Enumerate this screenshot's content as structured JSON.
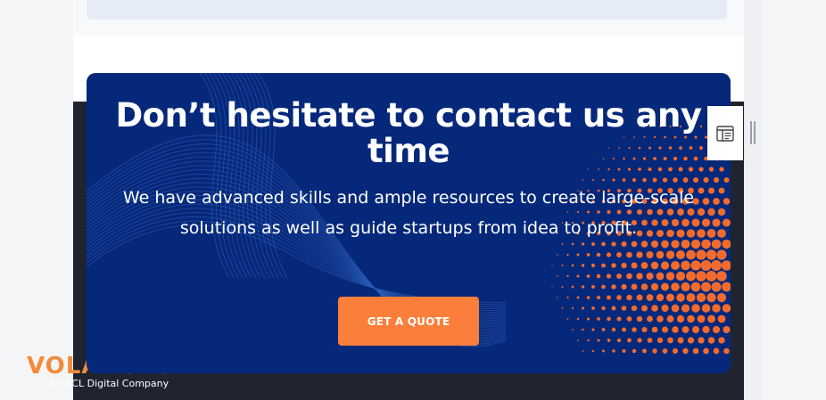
{
  "cta": {
    "title": "Don’t hesitate to contact us any time",
    "subtitle": "We have advanced skills and ample resources to create large-scale solutions as well as guide startups from idea to profit.",
    "button_label": "GET A QUOTE"
  },
  "footer": {
    "logo_text": "VOLANSYS",
    "tagline": "An ACL Digital Company"
  },
  "side_widget": {
    "icon": "layout-panel-icon"
  },
  "colors": {
    "cta_background": "#06287a",
    "button": "#fb7f3b",
    "footer_background": "#1f2430",
    "dots": "#f26b2e"
  }
}
